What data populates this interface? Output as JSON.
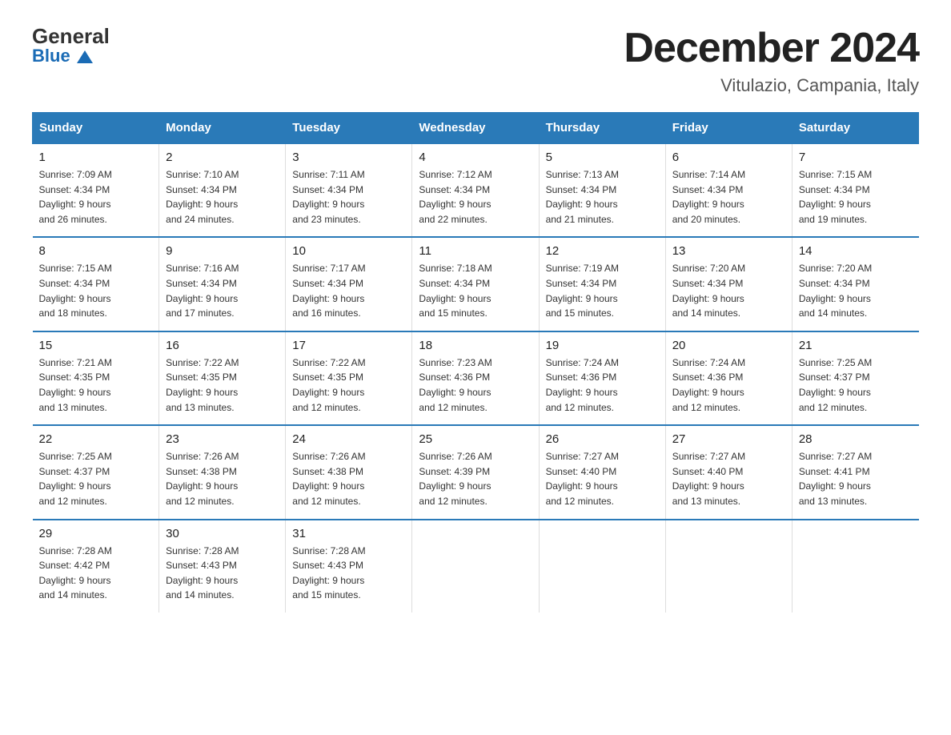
{
  "header": {
    "logo_general": "General",
    "logo_blue": "Blue",
    "month": "December 2024",
    "location": "Vitulazio, Campania, Italy"
  },
  "days_of_week": [
    "Sunday",
    "Monday",
    "Tuesday",
    "Wednesday",
    "Thursday",
    "Friday",
    "Saturday"
  ],
  "weeks": [
    [
      {
        "day": "1",
        "sunrise": "7:09 AM",
        "sunset": "4:34 PM",
        "daylight": "9 hours and 26 minutes."
      },
      {
        "day": "2",
        "sunrise": "7:10 AM",
        "sunset": "4:34 PM",
        "daylight": "9 hours and 24 minutes."
      },
      {
        "day": "3",
        "sunrise": "7:11 AM",
        "sunset": "4:34 PM",
        "daylight": "9 hours and 23 minutes."
      },
      {
        "day": "4",
        "sunrise": "7:12 AM",
        "sunset": "4:34 PM",
        "daylight": "9 hours and 22 minutes."
      },
      {
        "day": "5",
        "sunrise": "7:13 AM",
        "sunset": "4:34 PM",
        "daylight": "9 hours and 21 minutes."
      },
      {
        "day": "6",
        "sunrise": "7:14 AM",
        "sunset": "4:34 PM",
        "daylight": "9 hours and 20 minutes."
      },
      {
        "day": "7",
        "sunrise": "7:15 AM",
        "sunset": "4:34 PM",
        "daylight": "9 hours and 19 minutes."
      }
    ],
    [
      {
        "day": "8",
        "sunrise": "7:15 AM",
        "sunset": "4:34 PM",
        "daylight": "9 hours and 18 minutes."
      },
      {
        "day": "9",
        "sunrise": "7:16 AM",
        "sunset": "4:34 PM",
        "daylight": "9 hours and 17 minutes."
      },
      {
        "day": "10",
        "sunrise": "7:17 AM",
        "sunset": "4:34 PM",
        "daylight": "9 hours and 16 minutes."
      },
      {
        "day": "11",
        "sunrise": "7:18 AM",
        "sunset": "4:34 PM",
        "daylight": "9 hours and 15 minutes."
      },
      {
        "day": "12",
        "sunrise": "7:19 AM",
        "sunset": "4:34 PM",
        "daylight": "9 hours and 15 minutes."
      },
      {
        "day": "13",
        "sunrise": "7:20 AM",
        "sunset": "4:34 PM",
        "daylight": "9 hours and 14 minutes."
      },
      {
        "day": "14",
        "sunrise": "7:20 AM",
        "sunset": "4:34 PM",
        "daylight": "9 hours and 14 minutes."
      }
    ],
    [
      {
        "day": "15",
        "sunrise": "7:21 AM",
        "sunset": "4:35 PM",
        "daylight": "9 hours and 13 minutes."
      },
      {
        "day": "16",
        "sunrise": "7:22 AM",
        "sunset": "4:35 PM",
        "daylight": "9 hours and 13 minutes."
      },
      {
        "day": "17",
        "sunrise": "7:22 AM",
        "sunset": "4:35 PM",
        "daylight": "9 hours and 12 minutes."
      },
      {
        "day": "18",
        "sunrise": "7:23 AM",
        "sunset": "4:36 PM",
        "daylight": "9 hours and 12 minutes."
      },
      {
        "day": "19",
        "sunrise": "7:24 AM",
        "sunset": "4:36 PM",
        "daylight": "9 hours and 12 minutes."
      },
      {
        "day": "20",
        "sunrise": "7:24 AM",
        "sunset": "4:36 PM",
        "daylight": "9 hours and 12 minutes."
      },
      {
        "day": "21",
        "sunrise": "7:25 AM",
        "sunset": "4:37 PM",
        "daylight": "9 hours and 12 minutes."
      }
    ],
    [
      {
        "day": "22",
        "sunrise": "7:25 AM",
        "sunset": "4:37 PM",
        "daylight": "9 hours and 12 minutes."
      },
      {
        "day": "23",
        "sunrise": "7:26 AM",
        "sunset": "4:38 PM",
        "daylight": "9 hours and 12 minutes."
      },
      {
        "day": "24",
        "sunrise": "7:26 AM",
        "sunset": "4:38 PM",
        "daylight": "9 hours and 12 minutes."
      },
      {
        "day": "25",
        "sunrise": "7:26 AM",
        "sunset": "4:39 PM",
        "daylight": "9 hours and 12 minutes."
      },
      {
        "day": "26",
        "sunrise": "7:27 AM",
        "sunset": "4:40 PM",
        "daylight": "9 hours and 12 minutes."
      },
      {
        "day": "27",
        "sunrise": "7:27 AM",
        "sunset": "4:40 PM",
        "daylight": "9 hours and 13 minutes."
      },
      {
        "day": "28",
        "sunrise": "7:27 AM",
        "sunset": "4:41 PM",
        "daylight": "9 hours and 13 minutes."
      }
    ],
    [
      {
        "day": "29",
        "sunrise": "7:28 AM",
        "sunset": "4:42 PM",
        "daylight": "9 hours and 14 minutes."
      },
      {
        "day": "30",
        "sunrise": "7:28 AM",
        "sunset": "4:43 PM",
        "daylight": "9 hours and 14 minutes."
      },
      {
        "day": "31",
        "sunrise": "7:28 AM",
        "sunset": "4:43 PM",
        "daylight": "9 hours and 15 minutes."
      },
      null,
      null,
      null,
      null
    ]
  ],
  "labels": {
    "sunrise": "Sunrise:",
    "sunset": "Sunset:",
    "daylight": "Daylight:"
  }
}
